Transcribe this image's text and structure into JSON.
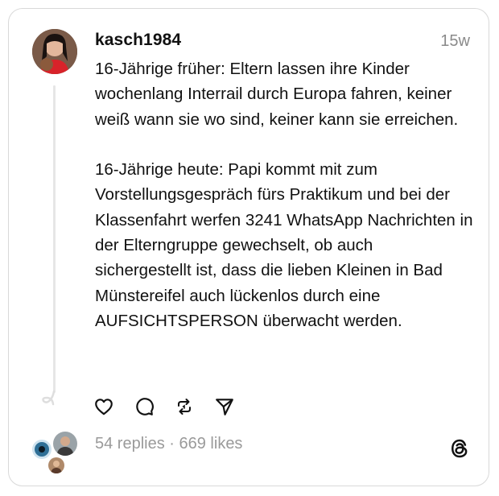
{
  "post": {
    "username": "kasch1984",
    "timestamp": "15w",
    "text": "16-Jährige früher: Eltern lassen ihre Kinder wochenlang Interrail durch Europa fahren, keiner weiß wann sie wo sind, keiner kann sie erreichen.\n\n16-Jährige heute: Papi kommt mit zum Vorstellungsgespräch fürs Praktikum und bei der Klassenfahrt werfen 3241 WhatsApp Nachrichten in der Elterngruppe gewechselt, ob auch sichergestellt ist, dass die lieben Kleinen in Bad Münstereifel auch lückenlos durch eine AUFSICHTSPERSON überwacht werden."
  },
  "stats": {
    "replies": "54 replies",
    "separator": " · ",
    "likes": "669 likes"
  },
  "icons": {
    "like": "heart-icon",
    "reply": "comment-icon",
    "repost": "repost-icon",
    "share": "send-icon",
    "app": "threads-logo-icon"
  },
  "colors": {
    "text": "#111111",
    "muted": "#8a8a8a",
    "border": "#d9d9d9",
    "thread_line": "#e6e6e6"
  }
}
